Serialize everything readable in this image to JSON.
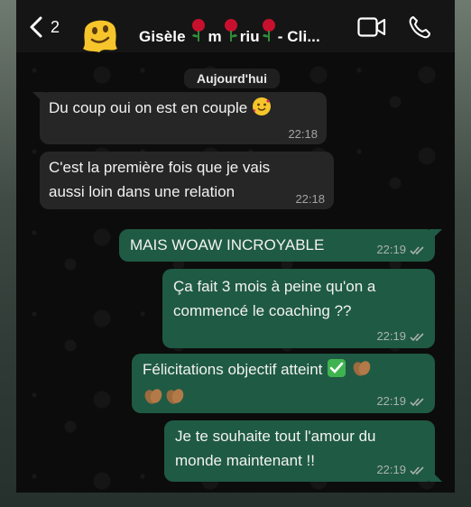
{
  "header": {
    "back_symbol": "<",
    "unread_count": "2",
    "contact_name": "Gisèle ",
    "contact_name_mid": "m",
    "contact_name_mid2": "riu",
    "contact_name_end": "- Cli..."
  },
  "chat": {
    "date_label": "Aujourd'hui",
    "messages": [
      {
        "text": "Du coup oui on est en couple",
        "time": "22:18",
        "direction": "in"
      },
      {
        "text": "C'est la première fois que je vais aussi loin dans une relation",
        "line1": "C'est la première fois que je vais",
        "line2": "aussi loin dans une relation",
        "time": "22:18",
        "direction": "in"
      },
      {
        "text": "MAIS WOAW INCROYABLE",
        "time": "22:19",
        "direction": "out"
      },
      {
        "text": "Ça fait 3 mois à peine qu'on a commencé le coaching ??",
        "line1": "Ça fait 3 mois à peine qu'on a",
        "line2": "commencé le coaching ??",
        "time": "22:19",
        "direction": "out"
      },
      {
        "text": "Félicitations objectif atteint",
        "time": "22:19",
        "direction": "out"
      },
      {
        "text": "Je te souhaite tout l'amour du monde maintenant !!",
        "line1": "Je te souhaite tout l'amour du",
        "line2": "monde maintenant !!",
        "time": "22:19",
        "direction": "out"
      }
    ]
  },
  "colors": {
    "incoming_bubble": "#262626",
    "outgoing_bubble": "#1f5a44",
    "header_bg": "#151515"
  },
  "icons": [
    "back-chevron-icon",
    "avatar-emoji",
    "rose-emoji",
    "video-call-icon",
    "phone-call-icon",
    "smiling-face-hearts-emoji",
    "check-mark-emoji",
    "clapping-hands-emoji",
    "double-check-icon"
  ]
}
